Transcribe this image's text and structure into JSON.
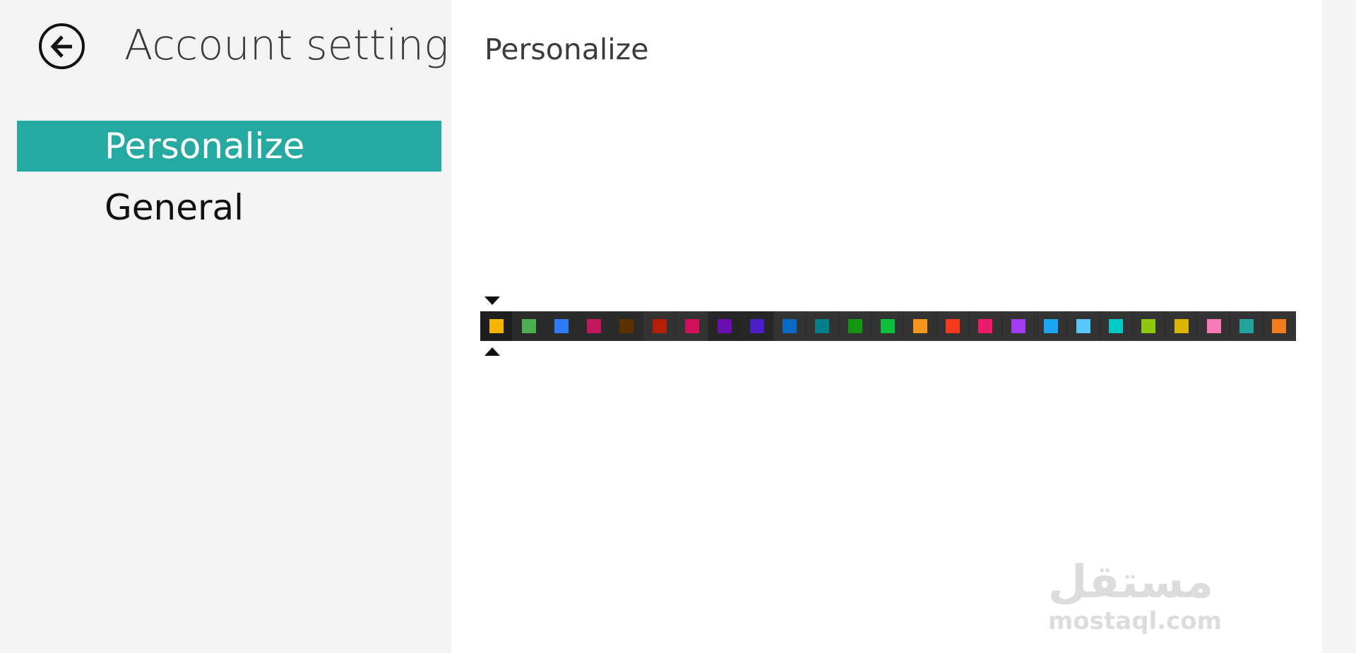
{
  "header": {
    "title": "Account settings"
  },
  "sidebar": {
    "items": [
      {
        "label": "Personalize",
        "selected": true
      },
      {
        "label": "General",
        "selected": false
      }
    ]
  },
  "main": {
    "title": "Personalize",
    "color_picker": {
      "selected_index": 0,
      "colors": [
        "#f4b400",
        "#4caf50",
        "#2f7bf5",
        "#c2185b",
        "#5d3200",
        "#b51f0a",
        "#d0105c",
        "#6a0dad",
        "#4a1fc7",
        "#0a69c7",
        "#007f86",
        "#149614",
        "#0cbf3c",
        "#f7941d",
        "#f5391a",
        "#ee1b6a",
        "#a33cf5",
        "#1ba5f2",
        "#58c6f7",
        "#00c9c7",
        "#8fc812",
        "#dbb500",
        "#f779b7",
        "#22a39b",
        "#f57b1f"
      ],
      "cell_backgrounds": [
        "#1e1e1e",
        "#2b2b2b",
        "#2b2b2b",
        "#2b2b2b",
        "#2b2b2b",
        "#333333",
        "#333333",
        "#262626",
        "#262626",
        "#333333",
        "#333333",
        "#333333",
        "#333333",
        "#333333",
        "#333333",
        "#333333",
        "#333333",
        "#333333",
        "#333333",
        "#333333",
        "#333333",
        "#333333",
        "#333333",
        "#333333",
        "#333333"
      ]
    }
  },
  "watermark": {
    "arabic": "مستقل",
    "latin": "mostaql.com"
  },
  "colors": {
    "accent": "#26a9a1",
    "sidebar_bg": "#f3f3f3",
    "content_bg": "#ffffff"
  },
  "icons": {
    "back": "arrow-left-circle-icon",
    "picker_top": "caret-down-icon",
    "picker_bottom": "caret-up-icon"
  }
}
